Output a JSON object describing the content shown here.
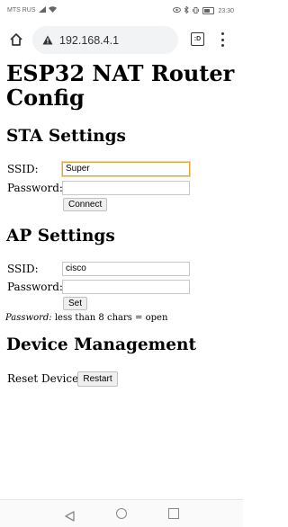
{
  "status": {
    "carrier": "MTS RUS",
    "time": "23:30"
  },
  "browser": {
    "url": "192.168.4.1",
    "tab_count": ":D"
  },
  "page": {
    "title": "ESP32 NAT Router Config",
    "sta": {
      "heading": "STA Settings",
      "ssid_label": "SSID:",
      "ssid_value": "Super",
      "password_label": "Password:",
      "password_value": "",
      "button": "Connect"
    },
    "ap": {
      "heading": "AP Settings",
      "ssid_label": "SSID:",
      "ssid_value": "cisco",
      "password_label": "Password:",
      "password_value": "",
      "button": "Set",
      "hint_label": "Password:",
      "hint_text": "less than 8 chars = open"
    },
    "device": {
      "heading": "Device Management",
      "reset_label": "Reset Device:",
      "button": "Restart"
    }
  }
}
